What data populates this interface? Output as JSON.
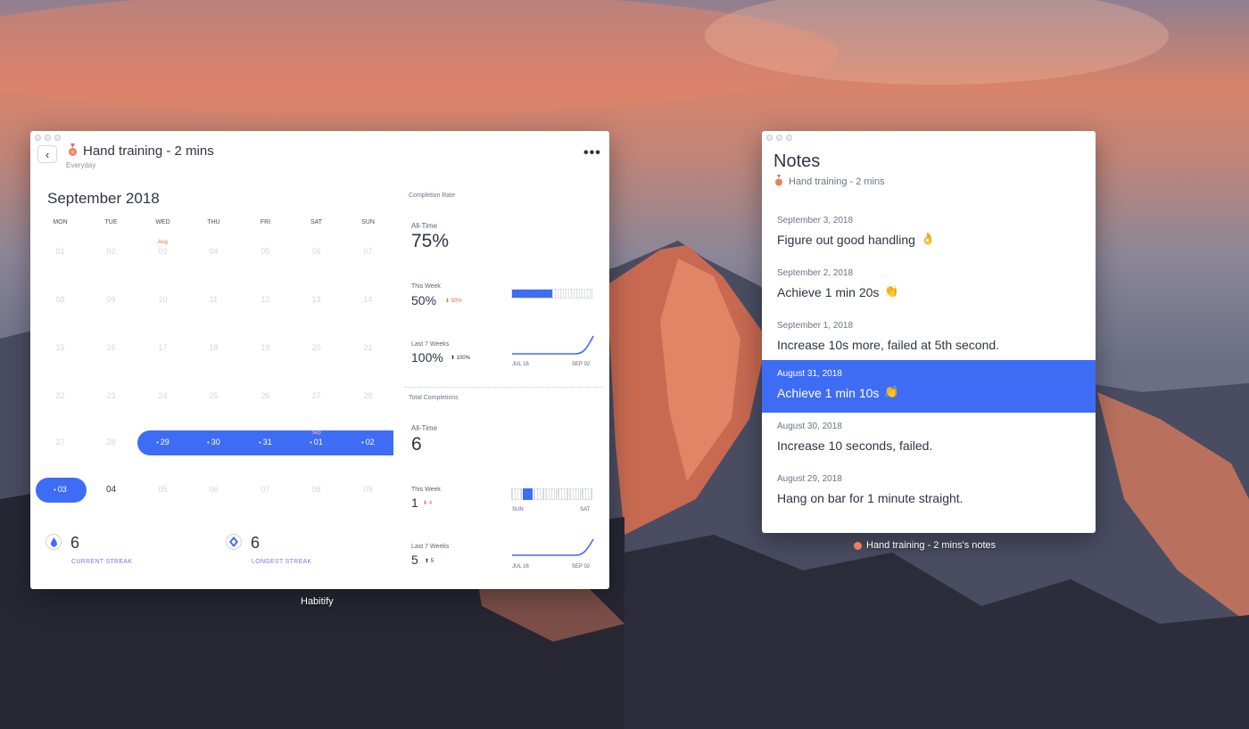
{
  "colors": {
    "accent": "#3f6cf5",
    "negative": "#e46c4f",
    "text": "#2f3444"
  },
  "main_window": {
    "caption": "Habitify",
    "habit": {
      "title": "Hand training - 2 mins",
      "subtitle": "Everyday",
      "icon": "medal-icon"
    },
    "calendar": {
      "month": "September",
      "year": "2018",
      "weekdays": [
        "MON",
        "TUE",
        "WED",
        "THU",
        "FRI",
        "SAT",
        "SUN"
      ],
      "marker_label": "Aug",
      "weeks": [
        [
          "01",
          "02",
          "03",
          "04",
          "05",
          "06",
          "07"
        ],
        [
          "08",
          "09",
          "10",
          "11",
          "12",
          "13",
          "14"
        ],
        [
          "15",
          "16",
          "17",
          "18",
          "19",
          "20",
          "21"
        ],
        [
          "22",
          "23",
          "24",
          "25",
          "26",
          "27",
          "28"
        ],
        [
          "27",
          "28",
          "29",
          "30",
          "31",
          "01",
          "02"
        ],
        [
          "03",
          "04",
          "05",
          "06",
          "07",
          "08",
          "09"
        ]
      ],
      "completed_label": "Sep",
      "today": "04"
    },
    "streaks": {
      "current": {
        "value": "6",
        "label": "CURRENT STREAK"
      },
      "longest": {
        "value": "6",
        "label": "LONGEST STREAK"
      }
    },
    "completion_rate": {
      "title": "Completion Rate",
      "all_time": {
        "label": "All-Time",
        "value": "75%"
      },
      "this_week": {
        "label": "This Week",
        "value": "50%",
        "delta": "50%",
        "delta_dir": "down",
        "bar_fraction": 0.5
      },
      "last_7_weeks": {
        "label": "Last 7 Weeks",
        "value": "100%",
        "delta": "100%",
        "delta_dir": "up",
        "x_start": "JUL 16",
        "x_end": "SEP 02"
      }
    },
    "total_completions": {
      "title": "Total Completions",
      "all_time": {
        "label": "All-Time",
        "value": "6"
      },
      "this_week": {
        "label": "This Week",
        "value": "1",
        "delta": "4",
        "delta_dir": "down",
        "x_start": "SUN",
        "x_end": "SAT"
      },
      "last_7_weeks": {
        "label": "Last 7 Weeks",
        "value": "5",
        "delta": "5",
        "delta_dir": "up",
        "x_start": "JUL 16",
        "x_end": "SEP 02"
      }
    }
  },
  "notes_window": {
    "title": "Notes",
    "subtitle": "Hand training - 2 mins",
    "caption": "Hand training - 2 mins's notes",
    "notes": [
      {
        "date": "September 3, 2018",
        "text": "Figure out good handling",
        "emoji": "👌"
      },
      {
        "date": "September 2, 2018",
        "text": "Achieve 1 min 20s",
        "emoji": "👏"
      },
      {
        "date": "September 1, 2018",
        "text": "Increase 10s more, failed at 5th second.",
        "emoji": ""
      },
      {
        "date": "August 31, 2018",
        "text": "Achieve 1 min 10s",
        "emoji": "👏"
      },
      {
        "date": "August 30, 2018",
        "text": "Increase 10 seconds, failed.",
        "emoji": ""
      },
      {
        "date": "August 29, 2018",
        "text": "Hang on bar for 1 minute straight.",
        "emoji": ""
      }
    ]
  }
}
